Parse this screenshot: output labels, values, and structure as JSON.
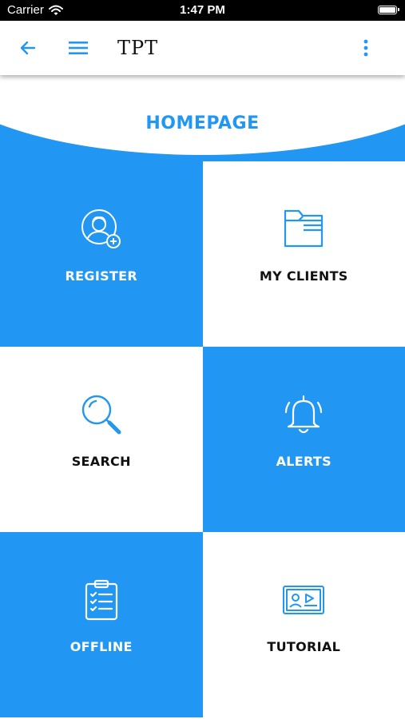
{
  "status_bar": {
    "carrier": "Carrier",
    "time": "1:47 PM"
  },
  "app_bar": {
    "title": "TPT"
  },
  "hero": {
    "title": "HOMEPAGE"
  },
  "tiles": [
    {
      "label": "REGISTER",
      "icon": "user-add-icon"
    },
    {
      "label": "MY CLIENTS",
      "icon": "folder-icon"
    },
    {
      "label": "SEARCH",
      "icon": "magnifier-icon"
    },
    {
      "label": "ALERTS",
      "icon": "bell-icon"
    },
    {
      "label": "OFFLINE",
      "icon": "clipboard-checklist-icon"
    },
    {
      "label": "TUTORIAL",
      "icon": "video-tutorial-icon"
    }
  ],
  "colors": {
    "primary": "#2196F3",
    "status_bar": "#000000",
    "dark_text": "#111111"
  }
}
